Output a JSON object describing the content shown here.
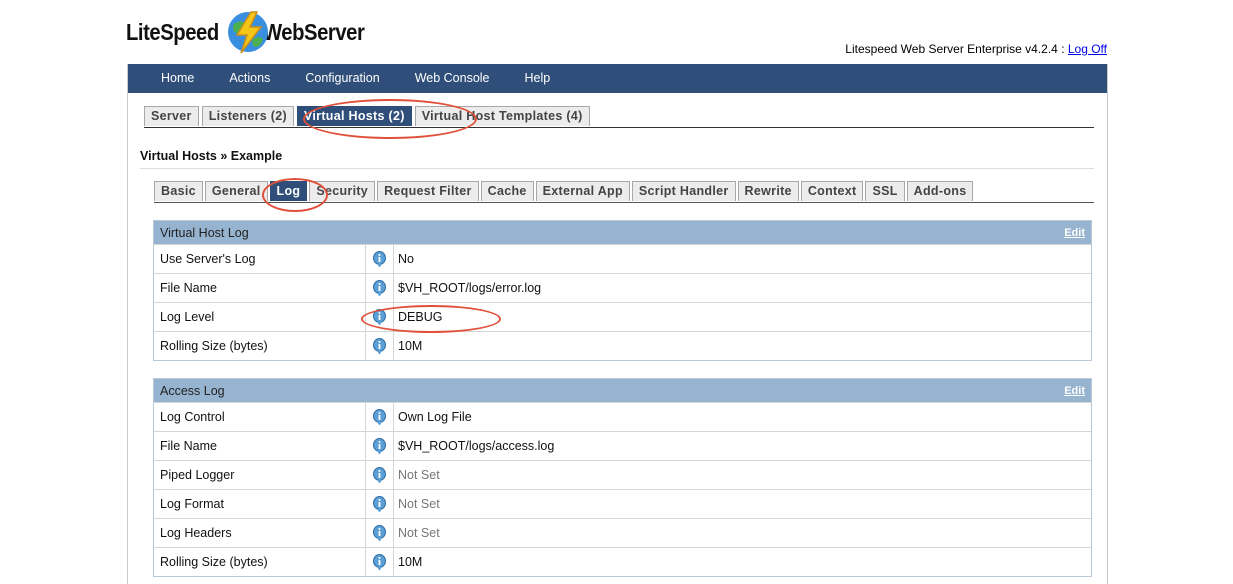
{
  "logo": {
    "left": "LiteSpeed",
    "right": "WebServer"
  },
  "header": {
    "product": "Litespeed Web Server Enterprise v4.2.4 : ",
    "logoff": "Log Off"
  },
  "nav": [
    "Home",
    "Actions",
    "Configuration",
    "Web Console",
    "Help"
  ],
  "top_tabs": [
    {
      "label": "Server"
    },
    {
      "label": "Listeners (2)"
    },
    {
      "label": "Virtual Hosts (2)"
    },
    {
      "label": "Virtual Host Templates (4)"
    }
  ],
  "breadcrumb": "Virtual Hosts » Example",
  "sub_tabs": [
    {
      "label": "Basic"
    },
    {
      "label": "General"
    },
    {
      "label": "Log"
    },
    {
      "label": "Security"
    },
    {
      "label": "Request Filter"
    },
    {
      "label": "Cache"
    },
    {
      "label": "External App"
    },
    {
      "label": "Script Handler"
    },
    {
      "label": "Rewrite"
    },
    {
      "label": "Context"
    },
    {
      "label": "SSL"
    },
    {
      "label": "Add-ons"
    }
  ],
  "vhost_log": {
    "title": "Virtual Host Log",
    "edit": "Edit",
    "rows": [
      {
        "label": "Use Server's Log",
        "value": "No"
      },
      {
        "label": "File Name",
        "value": "$VH_ROOT/logs/error.log"
      },
      {
        "label": "Log Level",
        "value": "DEBUG"
      },
      {
        "label": "Rolling Size (bytes)",
        "value": "10M"
      }
    ]
  },
  "access_log": {
    "title": "Access Log",
    "edit": "Edit",
    "rows": [
      {
        "label": "Log Control",
        "value": "Own Log File"
      },
      {
        "label": "File Name",
        "value": "$VH_ROOT/logs/access.log"
      },
      {
        "label": "Piped Logger",
        "value": "Not Set"
      },
      {
        "label": "Log Format",
        "value": "Not Set"
      },
      {
        "label": "Log Headers",
        "value": "Not Set"
      },
      {
        "label": "Rolling Size (bytes)",
        "value": "10M"
      }
    ]
  },
  "colors": {
    "nav_bg": "#2f4f7a",
    "section_head": "#96b3cf",
    "annotation": "#e0503a"
  },
  "icons": {
    "info": "info-icon",
    "logo": "lightning-globe-icon"
  }
}
